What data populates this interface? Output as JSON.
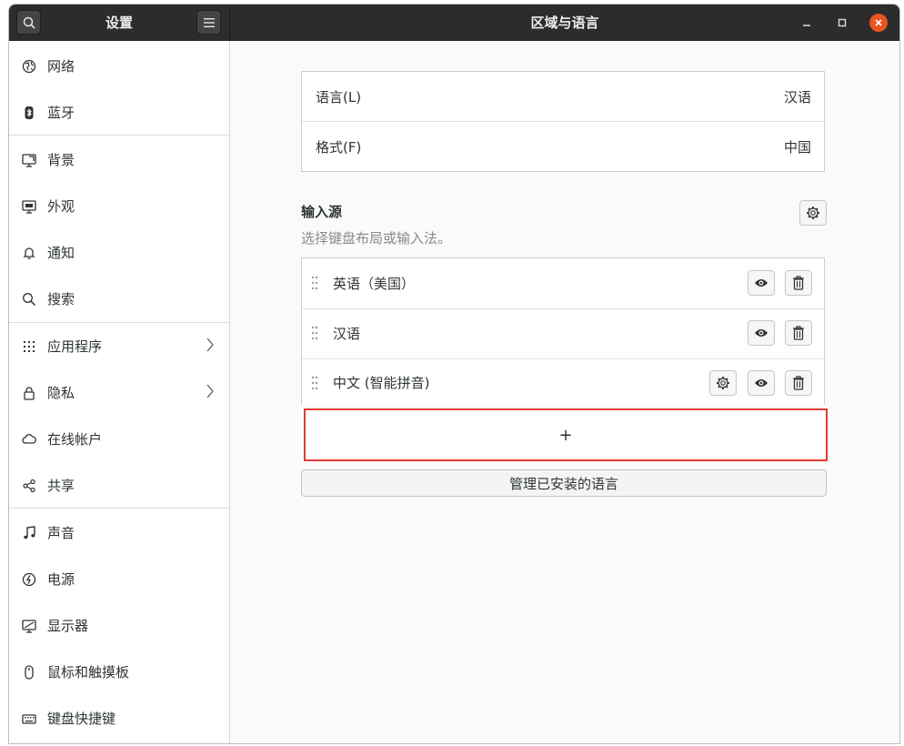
{
  "header": {
    "app_title": "设置",
    "window_title": "区域与语言"
  },
  "sidebar": {
    "items": [
      {
        "label": "网络",
        "icon": "network-icon"
      },
      {
        "label": "蓝牙",
        "icon": "bluetooth-icon"
      },
      {
        "label": "背景",
        "icon": "background-icon"
      },
      {
        "label": "外观",
        "icon": "appearance-icon"
      },
      {
        "label": "通知",
        "icon": "bell-icon"
      },
      {
        "label": "搜索",
        "icon": "search-icon"
      },
      {
        "label": "应用程序",
        "icon": "apps-grid-icon",
        "arrow": true
      },
      {
        "label": "隐私",
        "icon": "lock-icon",
        "arrow": true
      },
      {
        "label": "在线帐户",
        "icon": "cloud-icon"
      },
      {
        "label": "共享",
        "icon": "share-icon"
      },
      {
        "label": "声音",
        "icon": "music-note-icon"
      },
      {
        "label": "电源",
        "icon": "power-icon"
      },
      {
        "label": "显示器",
        "icon": "display-icon"
      },
      {
        "label": "鼠标和触摸板",
        "icon": "mouse-icon"
      },
      {
        "label": "键盘快捷键",
        "icon": "keyboard-icon"
      }
    ]
  },
  "region": {
    "language_label": "语言(L)",
    "language_value": "汉语",
    "format_label": "格式(F)",
    "format_value": "中国"
  },
  "input_sources": {
    "title": "输入源",
    "subtitle": "选择键盘布局或输入法。",
    "items": [
      {
        "label": "英语（美国）",
        "has_settings": false
      },
      {
        "label": "汉语",
        "has_settings": false
      },
      {
        "label": "中文 (智能拼音)",
        "has_settings": true
      }
    ],
    "add_label": "+",
    "manage_label": "管理已安装的语言"
  },
  "colors": {
    "accent": "#e95420",
    "highlight": "#e33b33",
    "header_bg": "#2c2c2c"
  }
}
